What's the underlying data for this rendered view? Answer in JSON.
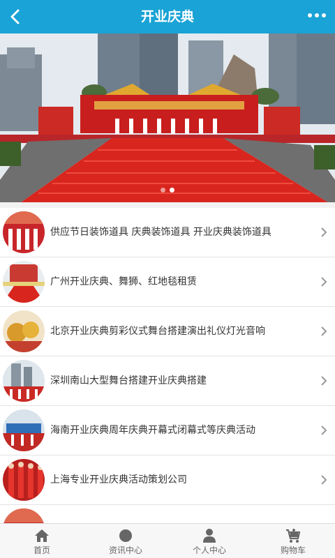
{
  "header": {
    "title": "开业庆典",
    "back_icon": "chevron-left-icon",
    "more_icon": "more-dots-icon"
  },
  "banner": {
    "slide_count": 2,
    "active_slide": 2
  },
  "articles": [
    {
      "title": "供应节日装饰道具 庆典装饰道具 开业庆典装饰道具"
    },
    {
      "title": "广州开业庆典、舞狮、红地毯租赁"
    },
    {
      "title": "北京开业庆典剪彩仪式舞台搭建演出礼仪灯光音响"
    },
    {
      "title": "深圳南山大型舞台搭建开业庆典搭建"
    },
    {
      "title": "海南开业庆典周年庆典开幕式闭幕式等庆典活动"
    },
    {
      "title": "上海专业开业庆典活动策划公司"
    }
  ],
  "tabbar": {
    "items": [
      {
        "label": "首页",
        "icon": "home-icon"
      },
      {
        "label": "资讯中心",
        "icon": "circle-icon"
      },
      {
        "label": "个人中心",
        "icon": "person-icon"
      },
      {
        "label": "购物车",
        "icon": "cart-icon"
      }
    ]
  },
  "colors": {
    "header_bg": "#1aa3d6",
    "accent_red": "#d8261e"
  }
}
